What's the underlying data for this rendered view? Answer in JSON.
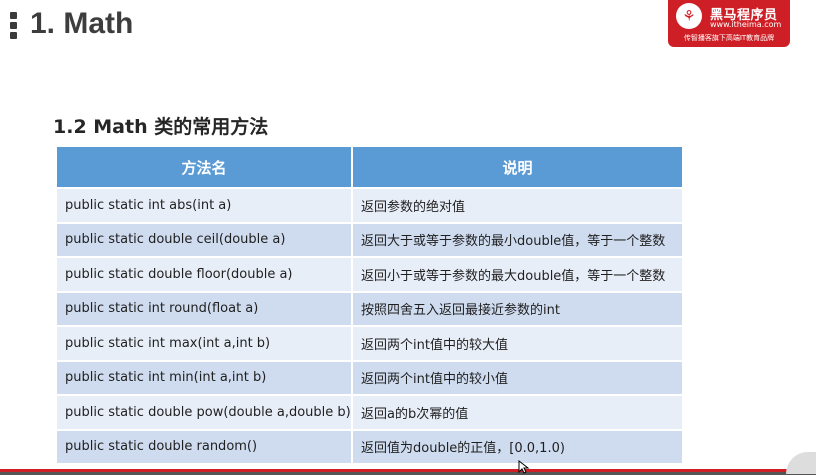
{
  "slide": {
    "title": "1. Math"
  },
  "logo": {
    "mark": "⚘",
    "name": "黑马程序员",
    "url": "www.itheima.com",
    "slogan": "传智播客旗下高端IT教育品牌"
  },
  "section": {
    "title": "1.2 Math 类的常用方法"
  },
  "table": {
    "headers": [
      "方法名",
      "说明"
    ],
    "rows": [
      {
        "method": "public static int abs(int a)",
        "desc": "返回参数的绝对值"
      },
      {
        "method": "public static double ceil(double a)",
        "desc": "返回大于或等于参数的最小double值，等于一个整数"
      },
      {
        "method": "public static double floor(double a)",
        "desc": "返回小于或等于参数的最大double值，等于一个整数"
      },
      {
        "method": "public static int round(float a)",
        "desc": "按照四舍五入返回最接近参数的int"
      },
      {
        "method": "public static int max(int a,int b)",
        "desc": "返回两个int值中的较大值"
      },
      {
        "method": "public static int min(int a,int b)",
        "desc": "返回两个int值中的较小值"
      },
      {
        "method": "public static double pow(double a,double b)",
        "desc": "返回a的b次幂的值"
      },
      {
        "method": "public static double random()",
        "desc": "返回值为double的正值，[0.0,1.0)"
      }
    ]
  },
  "colors": {
    "header": "#5b9bd5",
    "row_light": "#e8eef8",
    "row_dark": "#cfdcf0",
    "brand_red": "#cf1f26"
  }
}
